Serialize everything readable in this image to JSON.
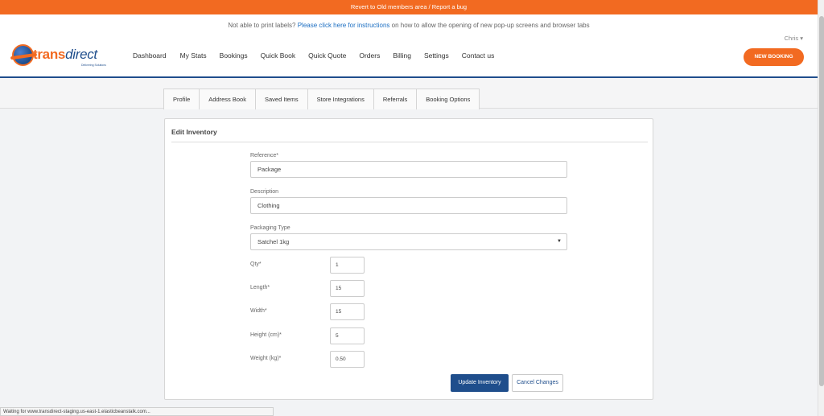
{
  "topbar": {
    "text": "Revert to Old members area / Report a bug"
  },
  "header": {
    "notice_prefix": "Not able to print labels?",
    "notice_link": "Please click here for instructions",
    "notice_suffix": "on how to allow the opening of new pop-up screens and browser tabs",
    "user_name": "Chris",
    "user_caret": "▾",
    "logo_word1": "trans",
    "logo_word2": "direct",
    "logo_tagline": "Delivering Solutions",
    "nav": [
      "Dashboard",
      "My Stats",
      "Bookings",
      "Quick Book",
      "Quick Quote",
      "Orders",
      "Billing",
      "Settings",
      "Contact us"
    ],
    "new_booking": "NEW BOOKING"
  },
  "tabs": [
    "Profile",
    "Address Book",
    "Saved Items",
    "Store Integrations",
    "Referrals",
    "Booking Options"
  ],
  "form": {
    "title": "Edit Inventory",
    "reference_label": "Reference*",
    "reference_value": "Package",
    "description_label": "Description",
    "description_value": "Clothing",
    "packaging_label": "Packaging Type",
    "packaging_value": "Satchel 1kg",
    "packaging_caret": "▼",
    "qty_label": "Qty*",
    "qty_value": "1",
    "length_label": "Length*",
    "length_value": "15",
    "width_label": "Width*",
    "width_value": "15",
    "height_label": "Height (cm)*",
    "height_value": "5",
    "weight_label": "Weight (kg)*",
    "weight_value": "0.50",
    "update_button": "Update Inventory",
    "cancel_button": "Cancel Changes"
  },
  "statusbar": {
    "text": "Waiting for www.transdirect-staging.us-east-1.elasticbeanstalk.com..."
  },
  "colors": {
    "accent": "#f26a21",
    "brand": "#1f4e8c",
    "link": "#1b6ec2"
  }
}
